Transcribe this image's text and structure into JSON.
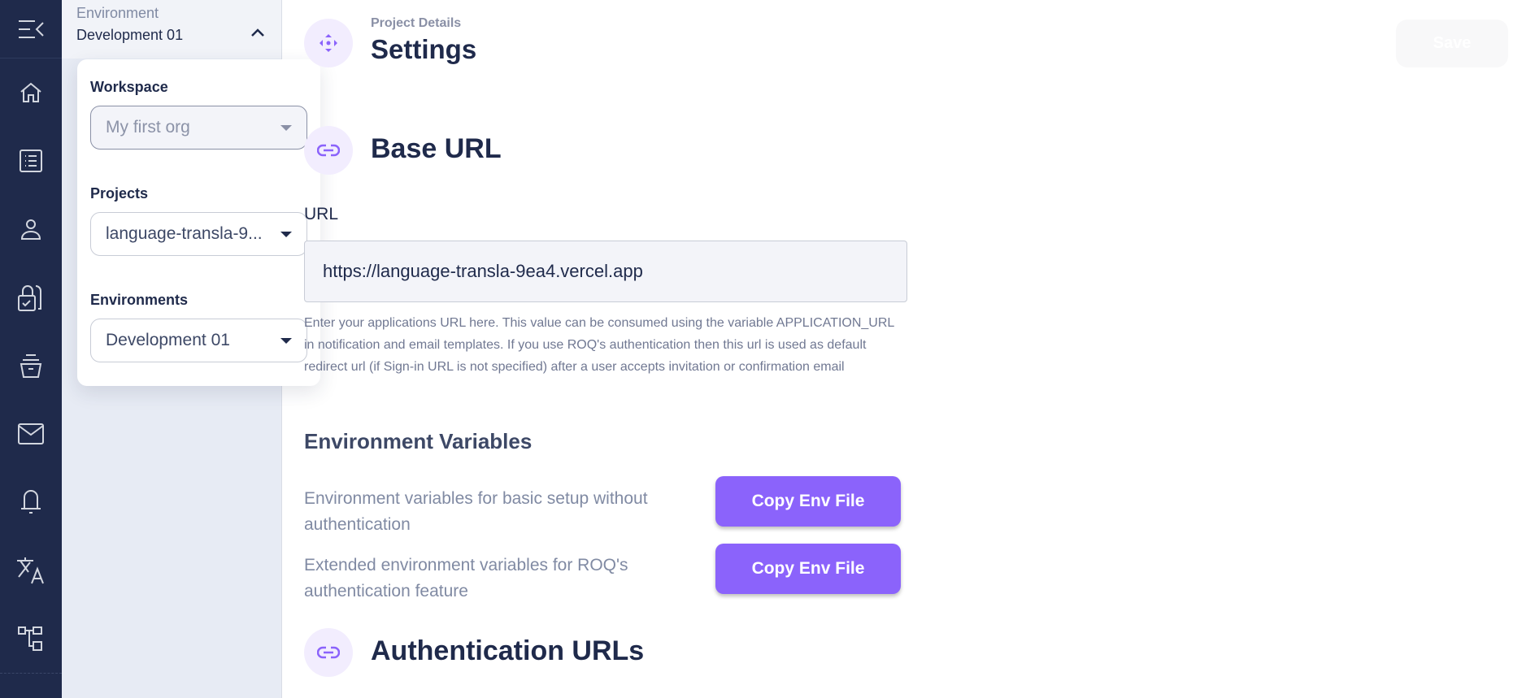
{
  "rail": {
    "items": [
      {
        "icon": "home-icon"
      },
      {
        "icon": "list-icon"
      },
      {
        "icon": "user-icon"
      },
      {
        "icon": "lock-check-icon"
      },
      {
        "icon": "archive-icon"
      },
      {
        "icon": "mail-icon"
      },
      {
        "icon": "bell-icon"
      },
      {
        "icon": "translate-icon"
      },
      {
        "icon": "hierarchy-icon"
      }
    ]
  },
  "environment": {
    "label": "Environment",
    "value": "Development 01"
  },
  "popover": {
    "workspace_label": "Workspace",
    "workspace_value": "My first org",
    "projects_label": "Projects",
    "projects_value": "language-transla-9...",
    "environments_label": "Environments",
    "environments_value": "Development 01"
  },
  "header": {
    "breadcrumb": "Project Details",
    "title": "Settings",
    "save_label": "Save"
  },
  "base_url": {
    "title": "Base URL",
    "field_label": "URL",
    "value": "https://language-transla-9ea4.vercel.app",
    "help": "Enter your applications URL here. This value can be consumed using the variable APPLICATION_URL in notification and email templates. If you use ROQ's authentication then this url is used as default redirect url (if Sign-in URL is not specified) after a user accepts invitation or confirmation email"
  },
  "env_vars": {
    "title": "Environment Variables",
    "rows": [
      {
        "description": "Environment variables for basic setup without authentication",
        "button": "Copy Env File"
      },
      {
        "description": "Extended environment variables for ROQ's authentication feature",
        "button": "Copy Env File"
      }
    ]
  },
  "auth_urls": {
    "title": "Authentication URLs"
  },
  "colors": {
    "accent": "#8b63fb",
    "rail": "#1f2a4b"
  }
}
